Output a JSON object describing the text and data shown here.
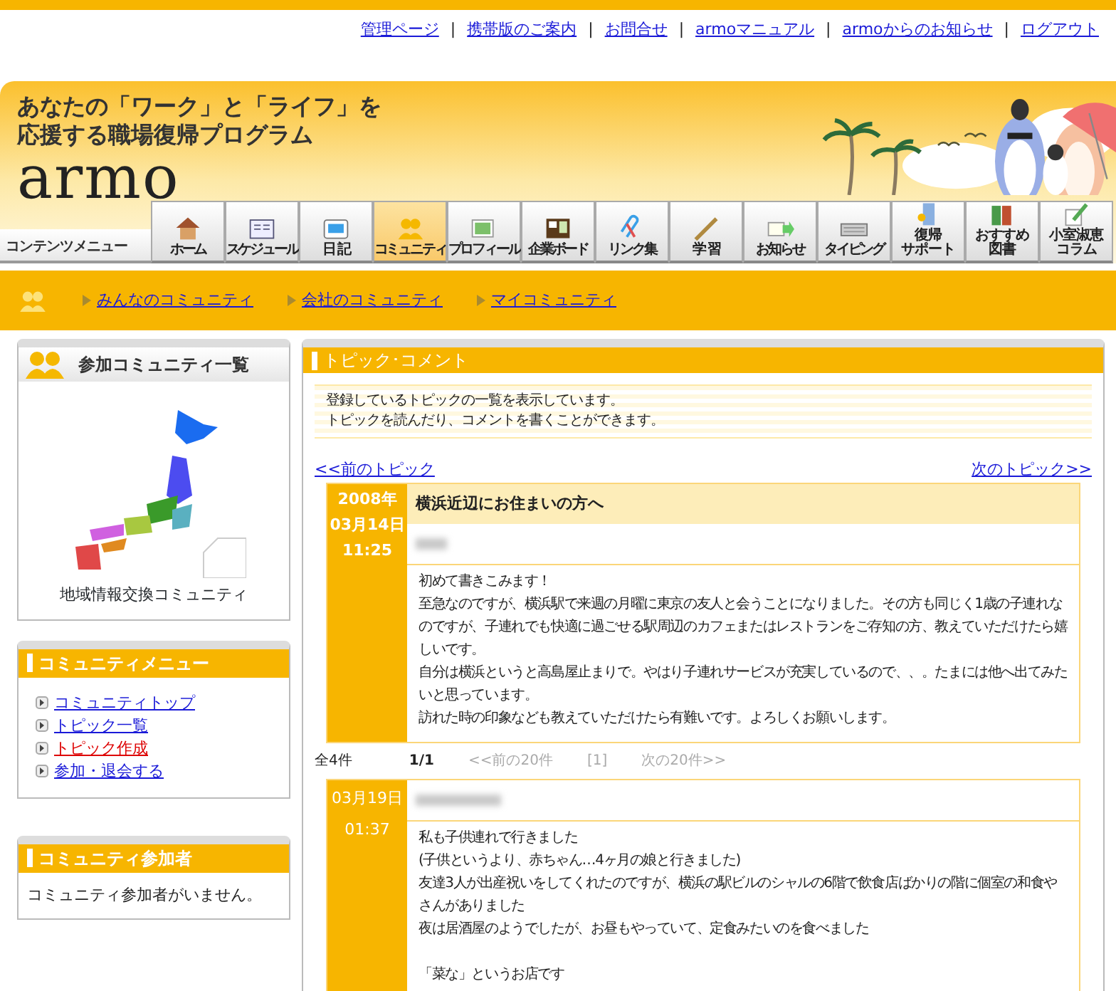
{
  "top_links": [
    "管理ページ",
    "携帯版のご案内",
    "お問合せ",
    "armoマニュアル",
    "armoからのお知らせ",
    "ログアウト"
  ],
  "top_link_separator": "|",
  "header": {
    "tagline_lines": [
      "あなたの「ワーク」と「ライフ」を",
      "応援する職場復帰プログラム"
    ],
    "logo": "armo",
    "menu_label": "コンテンツメニュー"
  },
  "nav_tabs": [
    {
      "label_lines": [
        "ホーム"
      ],
      "selected": false
    },
    {
      "label_lines": [
        "スケジュール"
      ],
      "selected": false
    },
    {
      "label_lines": [
        "日 記"
      ],
      "selected": false
    },
    {
      "label_lines": [
        "コミュニティ"
      ],
      "selected": true
    },
    {
      "label_lines": [
        "プロフィール"
      ],
      "selected": false
    },
    {
      "label_lines": [
        "企業ボード"
      ],
      "selected": false
    },
    {
      "label_lines": [
        "リンク集"
      ],
      "selected": false
    },
    {
      "label_lines": [
        "学 習"
      ],
      "selected": false
    },
    {
      "label_lines": [
        "お知らせ"
      ],
      "selected": false
    },
    {
      "label_lines": [
        "タイピング"
      ],
      "selected": false
    },
    {
      "label_lines": [
        "復帰",
        "サポート"
      ],
      "selected": false
    },
    {
      "label_lines": [
        "おすすめ",
        "図書"
      ],
      "selected": false
    },
    {
      "label_lines": [
        "小室淑恵",
        "コラム"
      ],
      "selected": false
    }
  ],
  "sub_nav": [
    "みんなのコミュニティ",
    "会社のコミュニティ",
    "マイコミュニティ"
  ],
  "sidebar": {
    "joined": {
      "title": "参加コミュニティ一覧",
      "community": "地域情報交換コミュニティ"
    },
    "menu": {
      "title": "コミュニティメニュー",
      "items": [
        {
          "label": "コミュニティトップ",
          "selected": false
        },
        {
          "label": "トピック一覧",
          "selected": false
        },
        {
          "label": "トピック作成",
          "selected": true
        },
        {
          "label": "参加・退会する",
          "selected": false
        }
      ]
    },
    "members": {
      "title": "コミュニティ参加者",
      "text": "コミュニティ参加者がいません。"
    }
  },
  "topic": {
    "title": "トピック･コメント",
    "notice": [
      "登録しているトピックの一覧を表示しています。",
      "トピックを読んだり、コメントを書くことができます。"
    ],
    "prev": "<<前のトピック",
    "next": "次のトピック>>",
    "post": {
      "date_lines": [
        "2008年",
        "03月14日",
        "11:25"
      ],
      "subject": "横浜近辺にお住まいの方へ",
      "body": [
        "初めて書きこみます！",
        "至急なのですが、横浜駅で来週の月曜に東京の友人と会うことになりました。その方も同じく1歳の子連れなのですが、子連れでも快適に過ごせる駅周辺のカフェまたはレストランをご存知の方、教えていただけたら嬉しいです。",
        "自分は横浜というと高島屋止まりで。やはり子連れサービスが充実しているので、、。たまには他へ出てみたいと思っています。",
        "訪れた時の印象なども教えていただけたら有難いです。よろしくお願いします。"
      ]
    },
    "pager": {
      "total": "全4件",
      "page": "1/1",
      "prev": "<<前の20件",
      "current": "[1]",
      "next": "次の20件>>"
    },
    "comments": [
      {
        "date_lines": [
          "03月19日",
          "01:37"
        ],
        "paragraphs": [
          [
            "私も子供連れで行きました",
            "(子供というより、赤ちゃん…4ヶ月の娘と行きました)",
            "友達3人が出産祝いをしてくれたのですが、横浜の駅ビルのシャルの6階で飲食店ばかりの階に個室の和食やさんがありました",
            "夜は居酒屋のようでしたが、お昼もやっていて、定食みたいのを食べました"
          ],
          [
            "「菜な」というお店です"
          ]
        ]
      }
    ]
  }
}
